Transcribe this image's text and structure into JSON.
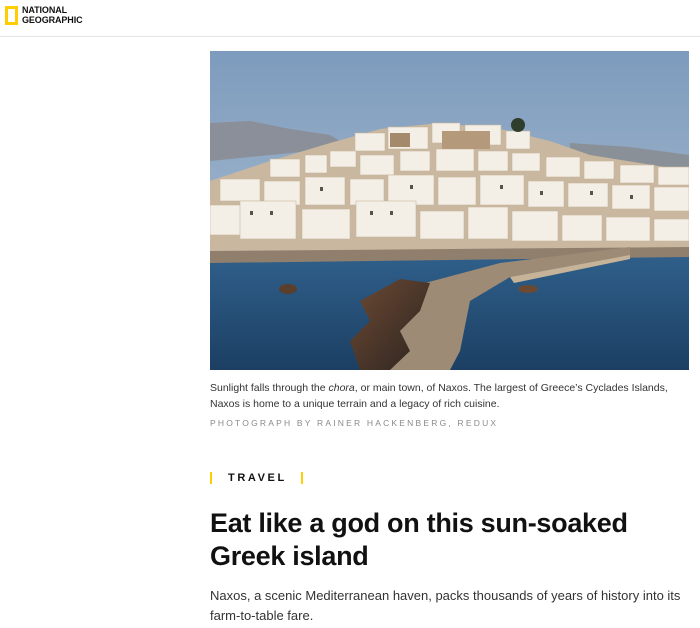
{
  "header": {
    "logo_line1": "NATIONAL",
    "logo_line2": "GEOGRAPHIC",
    "brand_color": "#ffce00"
  },
  "hero": {
    "alt": "Naxos chora at sunset with white houses and harbor"
  },
  "caption": {
    "part1": "Sunlight falls through the ",
    "italic": "chora",
    "part2": ", or main town, of Naxos. The largest of Greece’s Cyclades Islands, Naxos is home to a unique terrain and a legacy of rich cuisine."
  },
  "credit": "PHOTOGRAPH BY RAINER HACKENBERG, REDUX",
  "kicker": "TRAVEL",
  "headline": "Eat like a god on this sun-soaked Greek island",
  "dek": "Naxos, a scenic Mediterranean haven, packs thousands of years of history into its farm-to-table fare."
}
